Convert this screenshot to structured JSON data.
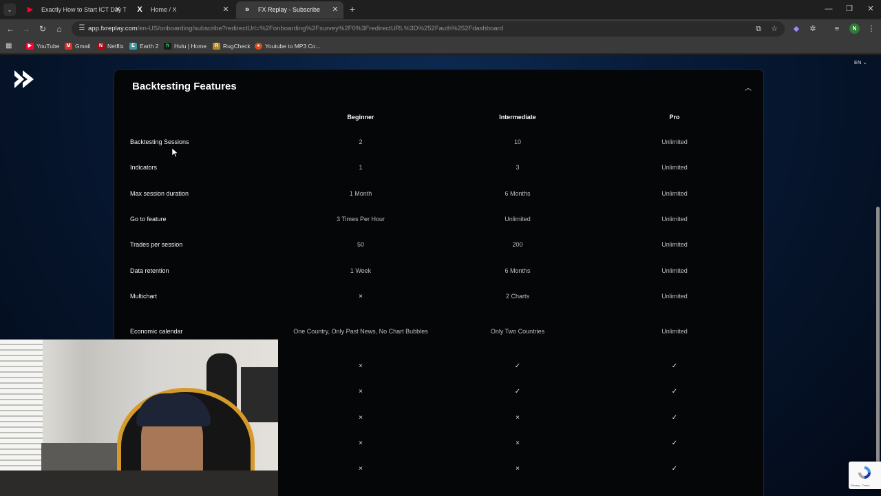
{
  "browser": {
    "tabs": [
      {
        "title": "Exactly How to Start ICT Day Tr",
        "icon": "youtube-icon",
        "icon_color": "#ff0033",
        "active": false
      },
      {
        "title": "Home / X",
        "icon": "x-logo-icon",
        "icon_color": "#ffffff",
        "active": false
      },
      {
        "title": "FX Replay - Subscribe",
        "icon": "fxreplay-icon",
        "icon_color": "#ffffff",
        "active": true
      }
    ],
    "url_host": "app.fxreplay.com",
    "url_path": "/en-US/onboarding/subscribe?redirectUrl=%2Fonboarding%2Fsurvey%2F0%3FredirectURL%3D%252Fauth%252Fdashboard",
    "profile_initial": "N",
    "bookmarks": [
      {
        "label": "YouTube",
        "icon": "youtube-icon",
        "color": "#ff0033",
        "glyph": "▶"
      },
      {
        "label": "Gmail",
        "icon": "gmail-icon",
        "color": "#d93025",
        "glyph": "M"
      },
      {
        "label": "Netflix",
        "icon": "netflix-icon",
        "color": "#b20710",
        "glyph": "N"
      },
      {
        "label": "Earth 2",
        "icon": "earth2-icon",
        "color": "#3d9aa0",
        "glyph": "E"
      },
      {
        "label": "Hulu | Home",
        "icon": "hulu-icon",
        "color": "#1a1a1a",
        "glyph": "h"
      },
      {
        "label": "RugCheck",
        "icon": "rugcheck-icon",
        "color": "#b08a2e",
        "glyph": "R"
      },
      {
        "label": "Youtube to MP3 Co...",
        "icon": "mp3-converter-icon",
        "color": "#d2501e",
        "glyph": "●"
      }
    ]
  },
  "page": {
    "language": "EN",
    "section_title": "Backtesting Features",
    "columns": [
      "Beginner",
      "Intermediate",
      "Pro"
    ],
    "rows": [
      {
        "label": "Backtesting Sessions",
        "values": [
          "2",
          "10",
          "Unlimited"
        ]
      },
      {
        "label": "Indicators",
        "values": [
          "1",
          "3",
          "Unlimited"
        ]
      },
      {
        "label": "Max session duration",
        "values": [
          "1 Month",
          "6 Months",
          "Unlimited"
        ]
      },
      {
        "label": "Go to feature",
        "values": [
          "3 Times Per Hour",
          "Unlimited",
          "Unlimited"
        ]
      },
      {
        "label": "Trades per session",
        "values": [
          "50",
          "200",
          "Unlimited"
        ]
      },
      {
        "label": "Data retention",
        "values": [
          "1 Week",
          "6 Months",
          "Unlimited"
        ]
      },
      {
        "label": "Multichart",
        "values": [
          "×",
          "2 Charts",
          "Unlimited"
        ]
      },
      {
        "label": "Economic calendar",
        "values": [
          "One Country, Only Past News, No Chart Bubbles",
          "Only Two Countries",
          "Unlimited"
        ]
      }
    ],
    "mark_rows": [
      [
        "×",
        "✓",
        "✓"
      ],
      [
        "×",
        "✓",
        "✓"
      ],
      [
        "×",
        "×",
        "✓"
      ],
      [
        "×",
        "×",
        "✓"
      ],
      [
        "×",
        "×",
        "✓"
      ]
    ],
    "recaptcha_terms": "Privacy - Terms"
  }
}
